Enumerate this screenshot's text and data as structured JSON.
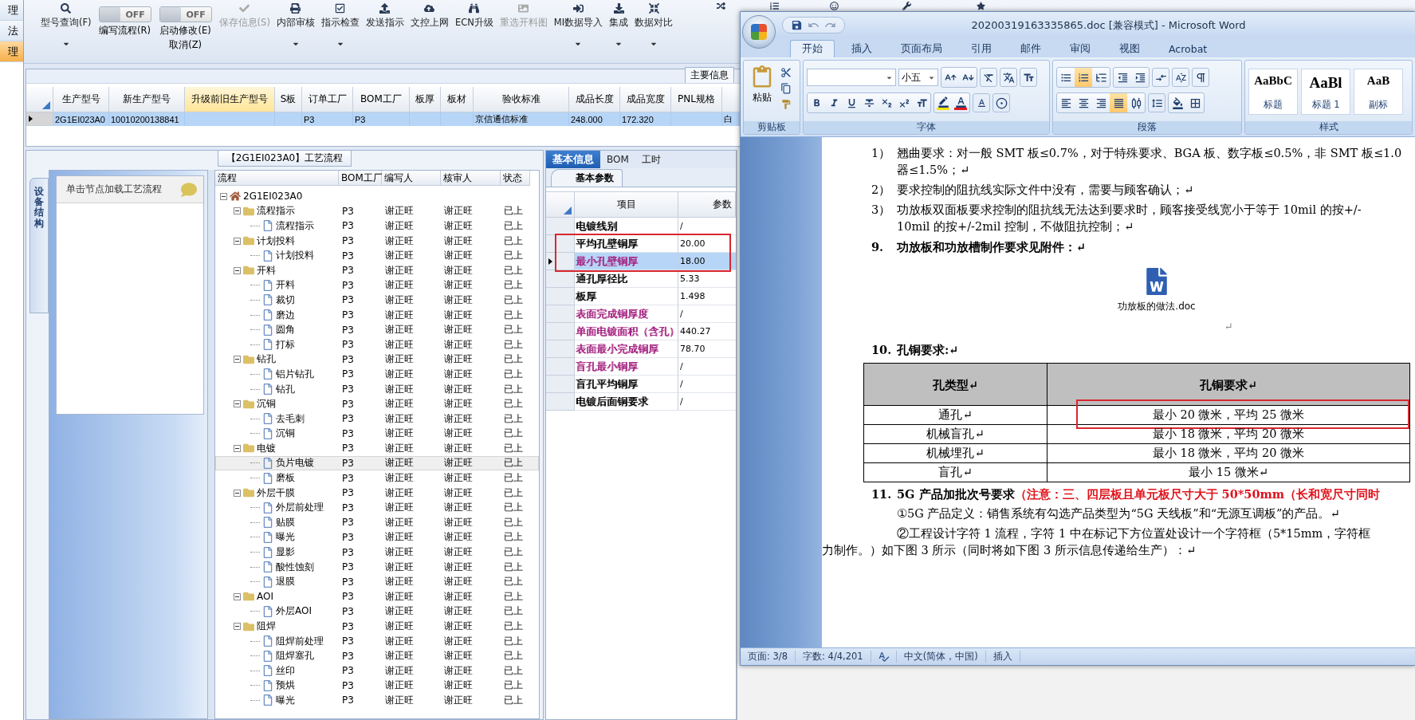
{
  "left_strip": [
    {
      "label": "理",
      "selected": false
    },
    {
      "label": "法",
      "selected": false
    },
    {
      "label": "理",
      "selected": true
    }
  ],
  "toolbar": [
    {
      "kind": "button",
      "label": "型号查询(F)",
      "dropdown": true,
      "disabled": false
    },
    {
      "kind": "toggle",
      "on": false,
      "state_text": "OFF",
      "label": "编写流程(R)"
    },
    {
      "kind": "toggle",
      "on": false,
      "state_text": "OFF",
      "label": "启动修改(E)",
      "sublabel": "取消(Z)"
    },
    {
      "kind": "button",
      "label": "保存信息(S)",
      "dropdown": false,
      "disabled": true
    },
    {
      "kind": "button",
      "label": "内部审核",
      "dropdown": true,
      "disabled": false
    },
    {
      "kind": "button",
      "label": "指示检查",
      "dropdown": true,
      "disabled": false
    },
    {
      "kind": "button",
      "label": "发送指示",
      "dropdown": false,
      "disabled": false
    },
    {
      "kind": "button",
      "label": "文控上网",
      "dropdown": false,
      "disabled": false
    },
    {
      "kind": "button",
      "label": "ECN升级",
      "dropdown": false,
      "disabled": false
    },
    {
      "kind": "button",
      "label": "重选开料图",
      "dropdown": false,
      "disabled": true
    },
    {
      "kind": "button",
      "label": "MI数据导入",
      "dropdown": true,
      "disabled": false
    },
    {
      "kind": "button",
      "label": "集成",
      "dropdown": true,
      "disabled": false
    },
    {
      "kind": "button",
      "label": "数据对比",
      "dropdown": true,
      "disabled": false
    },
    {
      "kind": "icon"
    },
    {
      "kind": "icon"
    },
    {
      "kind": "icon"
    },
    {
      "kind": "icon"
    },
    {
      "kind": "icon"
    }
  ],
  "main_info": {
    "tab": "主要信息",
    "columns": [
      {
        "label": "生产型号",
        "highlighted": false
      },
      {
        "label": "新生产型号",
        "highlighted": false
      },
      {
        "label": "升级前旧生产型号",
        "highlighted": true
      },
      {
        "label": "S板",
        "highlighted": false
      },
      {
        "label": "订单工厂",
        "highlighted": false
      },
      {
        "label": "BOM工厂",
        "highlighted": false
      },
      {
        "label": "板厚",
        "highlighted": false
      },
      {
        "label": "板材",
        "highlighted": false
      },
      {
        "label": "验收标准",
        "highlighted": false
      },
      {
        "label": "成品长度",
        "highlighted": false
      },
      {
        "label": "成品宽度",
        "highlighted": false
      },
      {
        "label": "PNL规格",
        "highlighted": false
      }
    ],
    "rows": [
      {
        "selected": true,
        "cells": [
          "2G1EI023A0",
          "10010200138841",
          "",
          "",
          "P3",
          "P3",
          "",
          "",
          "京信通信标准",
          "248.000",
          "172.320",
          "",
          "白"
        ]
      }
    ]
  },
  "process": {
    "title": "【2G1EI023A0】工艺流程",
    "side_tab": "设备结构",
    "hint": "单击节点加载工艺流程",
    "columns": [
      "流程",
      "BOM工厂",
      "编写人",
      "核审人",
      "状态"
    ],
    "root": {
      "label": "2G1EI023A0",
      "expanded": true,
      "selected": false,
      "children": [
        {
          "label": "流程指示",
          "bom": "P3",
          "writer": "谢正旺",
          "reviewer": "谢正旺",
          "status": "已上",
          "expanded": true,
          "selected": false,
          "children": [
            {
              "label": "流程指示",
              "bom": "P3",
              "writer": "谢正旺",
              "reviewer": "谢正旺",
              "status": "已上",
              "selected": false
            }
          ]
        },
        {
          "label": "计划投料",
          "bom": "P3",
          "writer": "谢正旺",
          "reviewer": "谢正旺",
          "status": "已上",
          "expanded": true,
          "selected": false,
          "children": [
            {
              "label": "计划投料",
              "bom": "P3",
              "writer": "谢正旺",
              "reviewer": "谢正旺",
              "status": "已上",
              "selected": false
            }
          ]
        },
        {
          "label": "开料",
          "bom": "P3",
          "writer": "谢正旺",
          "reviewer": "谢正旺",
          "status": "已上",
          "expanded": true,
          "selected": false,
          "children": [
            {
              "label": "开料",
              "bom": "P3",
              "writer": "谢正旺",
              "reviewer": "谢正旺",
              "status": "已上",
              "selected": false
            },
            {
              "label": "裁切",
              "bom": "P3",
              "writer": "谢正旺",
              "reviewer": "谢正旺",
              "status": "已上",
              "selected": false
            },
            {
              "label": "磨边",
              "bom": "P3",
              "writer": "谢正旺",
              "reviewer": "谢正旺",
              "status": "已上",
              "selected": false
            },
            {
              "label": "圆角",
              "bom": "P3",
              "writer": "谢正旺",
              "reviewer": "谢正旺",
              "status": "已上",
              "selected": false
            },
            {
              "label": "打标",
              "bom": "P3",
              "writer": "谢正旺",
              "reviewer": "谢正旺",
              "status": "已上",
              "selected": false
            }
          ]
        },
        {
          "label": "钻孔",
          "bom": "P3",
          "writer": "谢正旺",
          "reviewer": "谢正旺",
          "status": "已上",
          "expanded": true,
          "selected": false,
          "children": [
            {
              "label": "铝片钻孔",
              "bom": "P3",
              "writer": "谢正旺",
              "reviewer": "谢正旺",
              "status": "已上",
              "selected": false
            },
            {
              "label": "钻孔",
              "bom": "P3",
              "writer": "谢正旺",
              "reviewer": "谢正旺",
              "status": "已上",
              "selected": false
            }
          ]
        },
        {
          "label": "沉铜",
          "bom": "P3",
          "writer": "谢正旺",
          "reviewer": "谢正旺",
          "status": "已上",
          "expanded": true,
          "selected": false,
          "children": [
            {
              "label": "去毛刺",
              "bom": "P3",
              "writer": "谢正旺",
              "reviewer": "谢正旺",
              "status": "已上",
              "selected": false
            },
            {
              "label": "沉铜",
              "bom": "P3",
              "writer": "谢正旺",
              "reviewer": "谢正旺",
              "status": "已上",
              "selected": false
            }
          ]
        },
        {
          "label": "电镀",
          "bom": "P3",
          "writer": "谢正旺",
          "reviewer": "谢正旺",
          "status": "已上",
          "expanded": true,
          "selected": false,
          "children": [
            {
              "label": "负片电镀",
              "bom": "P3",
              "writer": "谢正旺",
              "reviewer": "谢正旺",
              "status": "已上",
              "selected": true
            },
            {
              "label": "磨板",
              "bom": "P3",
              "writer": "谢正旺",
              "reviewer": "谢正旺",
              "status": "已上",
              "selected": false
            }
          ]
        },
        {
          "label": "外层干膜",
          "bom": "P3",
          "writer": "谢正旺",
          "reviewer": "谢正旺",
          "status": "已上",
          "expanded": true,
          "selected": false,
          "children": [
            {
              "label": "外层前处理",
              "bom": "P3",
              "writer": "谢正旺",
              "reviewer": "谢正旺",
              "status": "已上",
              "selected": false
            },
            {
              "label": "贴膜",
              "bom": "P3",
              "writer": "谢正旺",
              "reviewer": "谢正旺",
              "status": "已上",
              "selected": false
            },
            {
              "label": "曝光",
              "bom": "P3",
              "writer": "谢正旺",
              "reviewer": "谢正旺",
              "status": "已上",
              "selected": false
            },
            {
              "label": "显影",
              "bom": "P3",
              "writer": "谢正旺",
              "reviewer": "谢正旺",
              "status": "已上",
              "selected": false
            },
            {
              "label": "酸性蚀刻",
              "bom": "P3",
              "writer": "谢正旺",
              "reviewer": "谢正旺",
              "status": "已上",
              "selected": false
            },
            {
              "label": "退膜",
              "bom": "P3",
              "writer": "谢正旺",
              "reviewer": "谢正旺",
              "status": "已上",
              "selected": false
            }
          ]
        },
        {
          "label": "AOI",
          "bom": "P3",
          "writer": "谢正旺",
          "reviewer": "谢正旺",
          "status": "已上",
          "expanded": true,
          "selected": false,
          "children": [
            {
              "label": "外层AOI",
              "bom": "P3",
              "writer": "谢正旺",
              "reviewer": "谢正旺",
              "status": "已上",
              "selected": false
            }
          ]
        },
        {
          "label": "阻焊",
          "bom": "P3",
          "writer": "谢正旺",
          "reviewer": "谢正旺",
          "status": "已上",
          "expanded": true,
          "selected": false,
          "children": [
            {
              "label": "阻焊前处理",
              "bom": "P3",
              "writer": "谢正旺",
              "reviewer": "谢正旺",
              "status": "已上",
              "selected": false
            },
            {
              "label": "阻焊塞孔",
              "bom": "P3",
              "writer": "谢正旺",
              "reviewer": "谢正旺",
              "status": "已上",
              "selected": false
            },
            {
              "label": "丝印",
              "bom": "P3",
              "writer": "谢正旺",
              "reviewer": "谢正旺",
              "status": "已上",
              "selected": false
            },
            {
              "label": "预烘",
              "bom": "P3",
              "writer": "谢正旺",
              "reviewer": "谢正旺",
              "status": "已上",
              "selected": false
            },
            {
              "label": "曝光",
              "bom": "P3",
              "writer": "谢正旺",
              "reviewer": "谢正旺",
              "status": "已上",
              "selected": false
            }
          ]
        }
      ]
    }
  },
  "params": {
    "tabs": [
      {
        "label": "基本信息",
        "selected": true
      },
      {
        "label": "BOM",
        "selected": false
      },
      {
        "label": "工时",
        "selected": false
      }
    ],
    "subtab": "基本参数",
    "columns": [
      "项目",
      "参数"
    ],
    "rows": [
      {
        "item": "电镀线别",
        "value": "/",
        "color": "#000000",
        "selected": false,
        "highlighted": false
      },
      {
        "item": "平均孔壁铜厚",
        "value": "20.00",
        "color": "#000000",
        "selected": false,
        "highlighted": true
      },
      {
        "item": "最小孔壁铜厚",
        "value": "18.00",
        "color": "#a3207f",
        "selected": true,
        "highlighted": true
      },
      {
        "item": "通孔厚径比",
        "value": "5.33",
        "color": "#000000",
        "selected": false,
        "highlighted": false
      },
      {
        "item": "板厚",
        "value": "1.498",
        "color": "#000000",
        "selected": false,
        "highlighted": false
      },
      {
        "item": "表面完成铜厚度",
        "value": "/",
        "color": "#a3207f",
        "selected": false,
        "highlighted": false
      },
      {
        "item": "单面电镀面积（含孔）",
        "value": "440.27",
        "color": "#a3207f",
        "selected": false,
        "highlighted": false
      },
      {
        "item": "表面最小完成铜厚",
        "value": "78.70",
        "color": "#a3207f",
        "selected": false,
        "highlighted": false
      },
      {
        "item": "盲孔最小铜厚",
        "value": "/",
        "color": "#a3207f",
        "selected": false,
        "highlighted": false
      },
      {
        "item": "盲孔平均铜厚",
        "value": "/",
        "color": "#000000",
        "selected": false,
        "highlighted": false
      },
      {
        "item": "电镀后面铜要求",
        "value": "/",
        "color": "#000000",
        "selected": false,
        "highlighted": false
      }
    ]
  },
  "word": {
    "title": "20200319163335865.doc [兼容模式] - Microsoft Word",
    "tabs": [
      {
        "label": "开始",
        "selected": true
      },
      {
        "label": "插入",
        "selected": false
      },
      {
        "label": "页面布局",
        "selected": false
      },
      {
        "label": "引用",
        "selected": false
      },
      {
        "label": "邮件",
        "selected": false
      },
      {
        "label": "审阅",
        "selected": false
      },
      {
        "label": "视图",
        "selected": false
      },
      {
        "label": "Acrobat",
        "selected": false
      }
    ],
    "clipboard": {
      "paste_label": "粘贴",
      "group_label": "剪贴板"
    },
    "font": {
      "group_label": "字体",
      "font_size": "小五"
    },
    "paragraph": {
      "group_label": "段落",
      "buttons": [
        {
          "selected": false
        },
        {
          "selected": true
        },
        {
          "selected": false
        },
        {
          "selected": false
        },
        {
          "selected": false
        },
        {
          "selected": false
        },
        {
          "selected": false
        },
        {
          "selected": false
        },
        {
          "selected": false
        },
        {
          "selected": false
        },
        {
          "selected": false
        },
        {
          "selected": true
        },
        {
          "selected": false
        },
        {
          "selected": false
        },
        {
          "selected": false
        },
        {
          "selected": false
        }
      ]
    },
    "styles": {
      "group_label": "样式",
      "tiles": [
        {
          "sample": "AaBbC",
          "label": "标题"
        },
        {
          "sample": "AaBl",
          "label": "标题 1"
        },
        {
          "sample": "AaB",
          "label": "副标"
        }
      ]
    },
    "document": [
      {
        "kind": "numbered",
        "number": "1）",
        "lines": [
          "翘曲要求：对一般 SMT 板≤0.7%，对于特殊要求、BGA 板、数字板≤0.5%，非 SMT 板≤1.0",
          "器≤1.5%；↵"
        ]
      },
      {
        "kind": "numbered",
        "number": "2）",
        "lines": [
          "要求控制的阻抗线实际文件中没有，需要与顾客确认；↵"
        ]
      },
      {
        "kind": "numbered",
        "number": "3）",
        "lines": [
          "功放板双面板要求控制的阻抗线无法达到要求时，顾客接受线宽小于等于 10mil 的按+/-",
          "10mil 的按+/-2mil 控制，不做阻抗控制；↵"
        ]
      },
      {
        "kind": "heading",
        "number": "9.",
        "text": "功放板和功放槽制作要求见附件：↵"
      },
      {
        "kind": "attachment",
        "file": "功放板的做法.doc",
        "mark": "↵"
      },
      {
        "kind": "heading",
        "number": "10.",
        "text": "孔铜要求:↵"
      },
      {
        "kind": "table",
        "header": [
          "孔类型↵",
          "孔铜要求↵"
        ],
        "rows": [
          {
            "cells": [
              "通孔↵",
              "最小 20 微米，平均 25 微米"
            ],
            "highlighted": true
          },
          {
            "cells": [
              "机械盲孔↵",
              "最小 18 微米，平均 20 微米"
            ],
            "highlighted": false
          },
          {
            "cells": [
              "机械埋孔↵",
              "最小 18 微米，平均 20 微米"
            ],
            "highlighted": false
          },
          {
            "cells": [
              "盲孔↵",
              "最小 15 微米↵"
            ],
            "highlighted": false
          }
        ]
      },
      {
        "kind": "heading",
        "number": "11.",
        "text": "5G 产品加批次号要求",
        "note": "（注意：三、四层板且单元板尺寸大于 50*50mm（长和宽尺寸同时"
      },
      {
        "kind": "indented",
        "lines": [
          "①5G 产品定义：销售系统有勾选产品类型为“5G 天线板”和“无源互调板”的产品。↵"
        ]
      },
      {
        "kind": "indented",
        "lines": [
          "②工程设计字符 1 流程，字符 1 中在标记下方位置处设计一个字符框（5*15mm，字符框",
          "力制作。）如下图 3 所示（同时将如下图 3 所示信息传递给生产）：↵"
        ]
      }
    ],
    "status_bar": [
      {
        "kind": "text",
        "text": "页面: 3/8"
      },
      {
        "kind": "text",
        "text": "字数: 4/4,201"
      },
      {
        "kind": "proofing"
      },
      {
        "kind": "text",
        "text": "中文(简体，中国)"
      },
      {
        "kind": "text",
        "text": "插入"
      }
    ]
  }
}
